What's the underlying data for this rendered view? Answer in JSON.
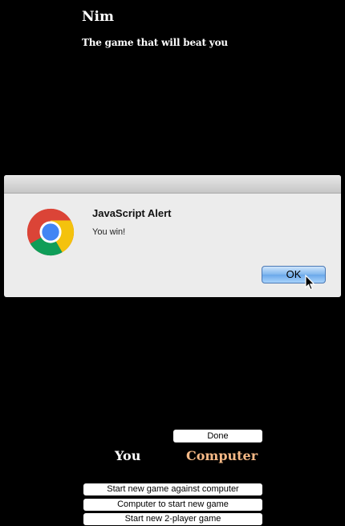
{
  "page": {
    "title": "Nim",
    "subtitle": "The game that will beat you"
  },
  "alert": {
    "heading": "JavaScript Alert",
    "message": "You win!",
    "ok_label": "OK",
    "icon": "chrome-logo-icon"
  },
  "game": {
    "done_label": "Done",
    "player_you": "You",
    "player_computer": "Computer",
    "active_player_color": "#f6b986"
  },
  "menu": {
    "new_game_vs_computer": "Start new game against computer",
    "computer_start": "Computer to start new game",
    "two_player": "Start new 2-player game"
  }
}
